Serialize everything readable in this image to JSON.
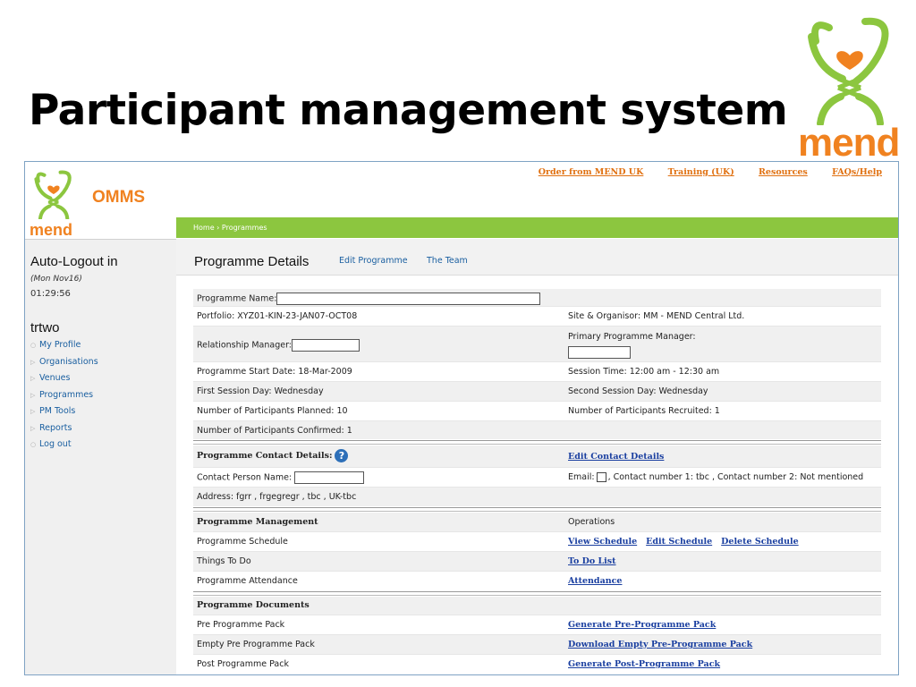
{
  "slide": {
    "title": "Participant management system",
    "logo_text": "mend"
  },
  "app": {
    "name": "OMMS",
    "logo_text": "mend"
  },
  "toplinks": [
    "Order from MEND UK",
    "Training (UK)",
    "Resources",
    "FAQs/Help"
  ],
  "breadcrumb": "Home › Programmes",
  "sidebar": {
    "autologout": "Auto-Logout in",
    "date": "(Mon Nov16)",
    "time": "01:29:56",
    "username": "trtwo",
    "items": [
      "My Profile",
      "Organisations",
      "Venues",
      "Programmes",
      "PM Tools",
      "Reports",
      "Log out"
    ]
  },
  "page": {
    "title": "Programme Details",
    "edit_link": "Edit Programme",
    "team_link": "The Team"
  },
  "details": {
    "programme_name_label": "Programme Name:",
    "portfolio": "Portfolio: XYZ01-KIN-23-JAN07-OCT08",
    "site": "Site & Organisor: MM - MEND Central Ltd.",
    "relationship_manager_label": "Relationship Manager:",
    "primary_manager_label": "Primary Programme Manager:",
    "start_date": "Programme Start Date: 18-Mar-2009",
    "session_time": "Session Time: 12:00 am - 12:30 am",
    "first_day": "First Session Day: Wednesday",
    "second_day": "Second Session Day: Wednesday",
    "planned": "Number of Participants Planned: 10",
    "recruited": "Number of Participants Recruited: 1",
    "confirmed": "Number of Participants Confirmed: 1"
  },
  "contact": {
    "heading": "Programme Contact Details:",
    "edit_link": "Edit Contact Details",
    "person_label": "Contact Person Name:",
    "email_label": "Email:",
    "email_rest": ", Contact number 1: tbc , Contact number 2: Not mentioned",
    "address": "Address: fgrr , frgegregr , tbc , UK-tbc"
  },
  "management": {
    "heading": "Programme Management",
    "operations": "Operations",
    "schedule_label": "Programme Schedule",
    "schedule_links": [
      "View Schedule",
      "Edit Schedule",
      "Delete Schedule"
    ],
    "todo_label": "Things To Do",
    "todo_link": "To Do List",
    "attendance_label": "Programme Attendance",
    "attendance_link": "Attendance"
  },
  "documents": {
    "heading": "Programme Documents",
    "pre_label": "Pre Programme Pack",
    "pre_link": "Generate Pre-Programme Pack",
    "empty_label": "Empty Pre Programme Pack",
    "empty_link": "Download Empty Pre-Programme Pack",
    "post_label": "Post Programme Pack",
    "post_link": "Generate Post-Programme Pack"
  },
  "colors": {
    "brand_orange": "#f08220",
    "brand_green": "#8cc63f",
    "link_blue": "#1a3fa0"
  }
}
